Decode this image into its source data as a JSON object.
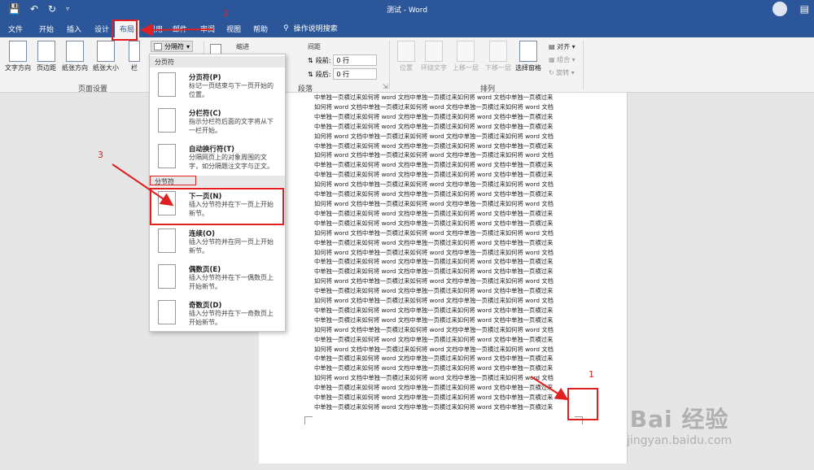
{
  "titlebar": {
    "title": "测试 - Word"
  },
  "quick_access": {
    "save_icon": "save-icon",
    "undo_icon": "undo-icon",
    "redo_icon": "redo-icon"
  },
  "tabs": [
    "文件",
    "开始",
    "插入",
    "设计",
    "布局",
    "引用",
    "邮件",
    "审阅",
    "视图",
    "帮助"
  ],
  "tell_me": "操作说明搜索",
  "ribbon": {
    "page_setup": {
      "buttons": [
        "文字方向",
        "页边距",
        "纸张方向",
        "纸张大小",
        "栏"
      ],
      "group_label": "页面设置",
      "breaks_label": "分隔符"
    },
    "paragraph": {
      "indent_label": "缩进",
      "spacing_label": "间距",
      "before_label": "段前:",
      "before_value": "0 行",
      "after_label": "段后:",
      "after_value": "0 行",
      "group_label": "段落"
    },
    "arrange": {
      "buttons": [
        "位置",
        "环绕文字",
        "上移一层",
        "下移一层",
        "选择窗格"
      ],
      "align": "对齐",
      "group": "组合",
      "rotate": "旋转",
      "group_label": "排列"
    }
  },
  "breaks_menu": {
    "section1_header": "分页符",
    "section2_header": "分节符",
    "items": [
      {
        "title": "分页符(P)",
        "desc": [
          "标记一页结束与下一页开始的",
          "位置。"
        ]
      },
      {
        "title": "分栏符(C)",
        "desc": [
          "指示分栏符后面的文字将从下",
          "一栏开始。"
        ]
      },
      {
        "title": "自动换行符(T)",
        "desc": [
          "分隔网页上的对象周围的文",
          "字，如分隔题注文字与正文。"
        ]
      },
      {
        "title": "下一页(N)",
        "desc": [
          "插入分节符并在下一页上开始",
          "新节。"
        ]
      },
      {
        "title": "连续(O)",
        "desc": [
          "插入分节符并在同一页上开始",
          "新节。"
        ]
      },
      {
        "title": "偶数页(E)",
        "desc": [
          "插入分节符并在下一偶数页上",
          "开始新节。"
        ]
      },
      {
        "title": "奇数页(D)",
        "desc": [
          "插入分节符并在下一奇数页上",
          "开始新节。"
        ]
      }
    ]
  },
  "document": {
    "lines": [
      "中单独一页横过来如何将 word 文档中单独一页横过来如何将 word 文档中单独一页横过来",
      "如何将 word 文档中单独一页横过来如何将 word 文档中单独一页横过来如何将 word 文档",
      "中单独一页横过来如何将 word 文档中单独一页横过来如何将 word 文档中单独一页横过来",
      "中单独一页横过来如何将 word 文档中单独一页横过来如何将 word 文档中单独一页横过来",
      "如何将 word 文档中单独一页横过来如何将 word 文档中单独一页横过来如何将 word 文档",
      "中单独一页横过来如何将 word 文档中单独一页横过来如何将 word 文档中单独一页横过来",
      "如何将 word 文档中单独一页横过来如何将 word 文档中单独一页横过来如何将 word 文档",
      "中单独一页横过来如何将 word 文档中单独一页横过来如何将 word 文档中单独一页横过来",
      "中单独一页横过来如何将 word 文档中单独一页横过来如何将 word 文档中单独一页横过来",
      "如何将 word 文档中单独一页横过来如何将 word 文档中单独一页横过来如何将 word 文档",
      "中单独一页横过来如何将 word 文档中单独一页横过来如何将 word 文档中单独一页横过来",
      "如何将 word 文档中单独一页横过来如何将 word 文档中单独一页横过来如何将 word 文档",
      "中单独一页横过来如何将 word 文档中单独一页横过来如何将 word 文档中单独一页横过来",
      "中单独一页横过来如何将 word 文档中单独一页横过来如何将 word 文档中单独一页横过来",
      "如何将 word 文档中单独一页横过来如何将 word 文档中单独一页横过来如何将 word 文档",
      "中单独一页横过来如何将 word 文档中单独一页横过来如何将 word 文档中单独一页横过来",
      "如何将 word 文档中单独一页横过来如何将 word 文档中单独一页横过来如何将 word 文档",
      "中单独一页横过来如何将 word 文档中单独一页横过来如何将 word 文档中单独一页横过来",
      "中单独一页横过来如何将 word 文档中单独一页横过来如何将 word 文档中单独一页横过来",
      "如何将 word 文档中单独一页横过来如何将 word 文档中单独一页横过来如何将 word 文档",
      "中单独一页横过来如何将 word 文档中单独一页横过来如何将 word 文档中单独一页横过来",
      "如何将 word 文档中单独一页横过来如何将 word 文档中单独一页横过来如何将 word 文档",
      "中单独一页横过来如何将 word 文档中单独一页横过来如何将 word 文档中单独一页横过来",
      "中单独一页横过来如何将 word 文档中单独一页横过来如何将 word 文档中单独一页横过来",
      "如何将 word 文档中单独一页横过来如何将 word 文档中单独一页横过来如何将 word 文档",
      "中单独一页横过来如何将 word 文档中单独一页横过来如何将 word 文档中单独一页横过来",
      "如何将 word 文档中单独一页横过来如何将 word 文档中单独一页横过来如何将 word 文档",
      "中单独一页横过来如何将 word 文档中单独一页横过来如何将 word 文档中单独一页横过来",
      "中单独一页横过来如何将 word 文档中单独一页横过来如何将 word 文档中单独一页横过来",
      "如何将 word 文档中单独一页横过来如何将 word 文档中单独一页横过来如何将 word 文档",
      "中单独一页横过来如何将 word 文档中单独一页横过来如何将 word 文档中单独一页横过来",
      "中单独一页横过来如何将 word 文档中单独一页横过来如何将 word 文档中单独一页横过来",
      "中单独一页横过来如何将 word 文档中单独一页横过来如何将 word 文档中单独一页横过来"
    ]
  },
  "annotations": {
    "step1": "1",
    "step2": "2",
    "step3": "3"
  },
  "watermark": {
    "logo": "Bai 经验",
    "url": "jingyan.baidu.com"
  },
  "colors": {
    "word_blue": "#2b579a",
    "annotation_red": "#e02020"
  }
}
